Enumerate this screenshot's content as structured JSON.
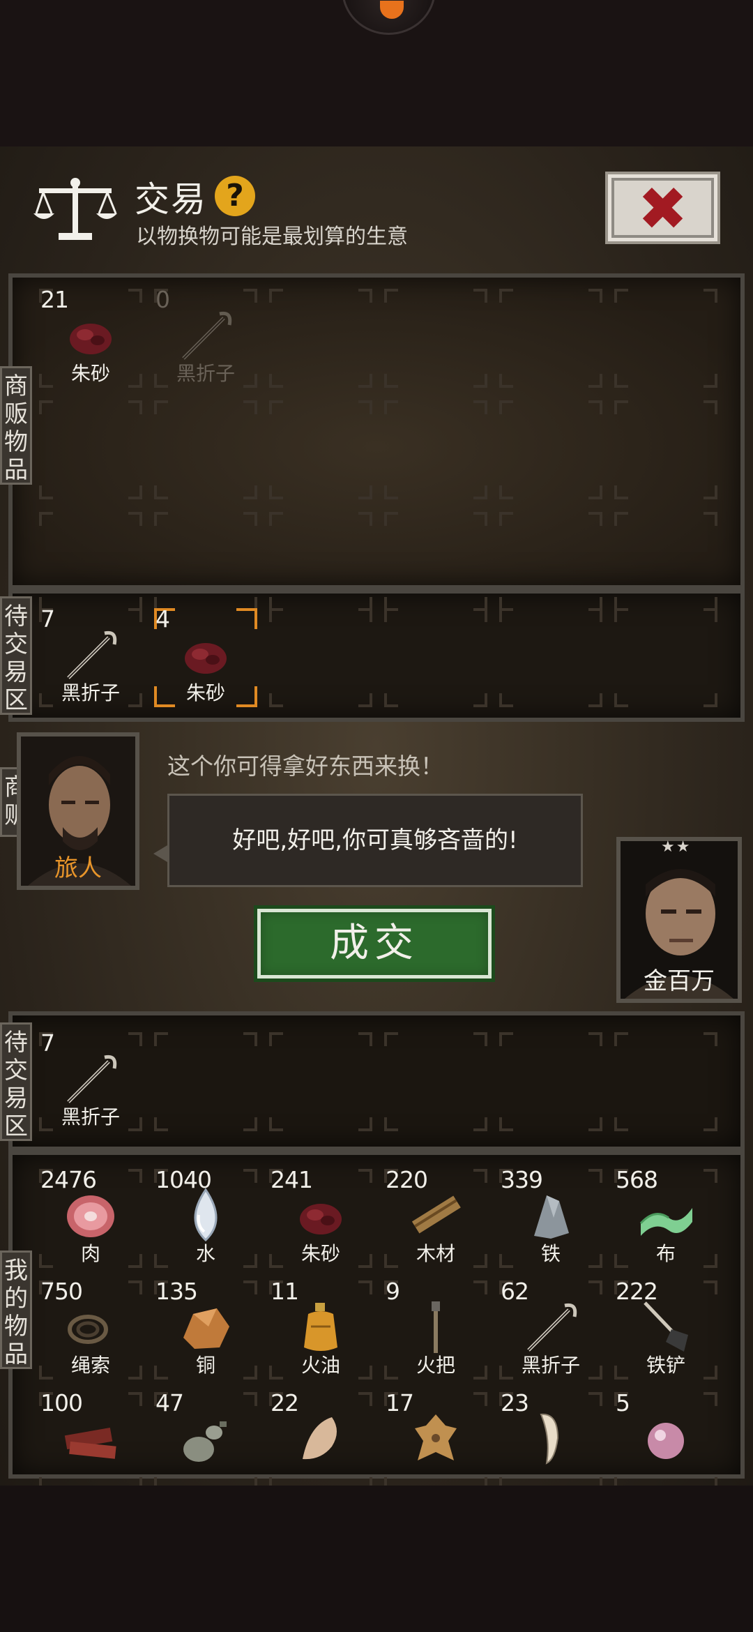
{
  "header": {
    "title": "交易",
    "help_icon": "question-icon",
    "subtitle": "以物换物可能是最划算的生意",
    "close_icon": "close-icon"
  },
  "labels": {
    "vendor_goods": "商贩物品",
    "pending_top": "待交易区",
    "vendor_tag": "商贩",
    "pending_bottom": "待交易区",
    "my_goods": "我的物品"
  },
  "vendor_items": [
    {
      "count": "21",
      "name": "朱砂",
      "icon": "cinnabar-icon"
    },
    {
      "count": "0",
      "name": "黑折子",
      "icon": "black-tongs-icon"
    }
  ],
  "vendor_pending": [
    {
      "count": "7",
      "name": "黑折子",
      "icon": "black-tongs-icon"
    },
    {
      "count": "4",
      "name": "朱砂",
      "icon": "cinnabar-icon"
    }
  ],
  "vendor": {
    "name": "旅人",
    "line": "这个你可得拿好东西来换！"
  },
  "player": {
    "name": "金百万",
    "stars": "★★",
    "reply": "好吧,好吧,你可真够吝啬的!"
  },
  "deal_button": "成交",
  "my_pending": [
    {
      "count": "7",
      "name": "黑折子",
      "icon": "black-tongs-icon"
    }
  ],
  "my_items": [
    {
      "count": "2476",
      "name": "肉",
      "icon": "meat-icon"
    },
    {
      "count": "1040",
      "name": "水",
      "icon": "water-drop-icon"
    },
    {
      "count": "241",
      "name": "朱砂",
      "icon": "cinnabar-icon"
    },
    {
      "count": "220",
      "name": "木材",
      "icon": "wood-icon"
    },
    {
      "count": "339",
      "name": "铁",
      "icon": "iron-icon"
    },
    {
      "count": "568",
      "name": "布",
      "icon": "cloth-icon"
    },
    {
      "count": "750",
      "name": "绳索",
      "icon": "rope-icon"
    },
    {
      "count": "135",
      "name": "铜",
      "icon": "copper-icon"
    },
    {
      "count": "11",
      "name": "火油",
      "icon": "fire-oil-icon"
    },
    {
      "count": "9",
      "name": "火把",
      "icon": "torch-icon"
    },
    {
      "count": "62",
      "name": "黑折子",
      "icon": "black-tongs-icon"
    },
    {
      "count": "222",
      "name": "铁铲",
      "icon": "shovel-icon"
    },
    {
      "count": "100",
      "icon": "dried-meat-icon"
    },
    {
      "count": "47",
      "icon": "gourd-icon"
    },
    {
      "count": "22",
      "icon": "bone-icon"
    },
    {
      "count": "17",
      "icon": "pelt-icon"
    },
    {
      "count": "23",
      "icon": "fang-icon"
    },
    {
      "count": "5",
      "icon": "pearl-icon"
    }
  ],
  "colors": {
    "accent": "#e08a23",
    "deal_green": "#2c6a2c",
    "close_red": "#a21a22",
    "help_gold": "#e3a51c"
  }
}
